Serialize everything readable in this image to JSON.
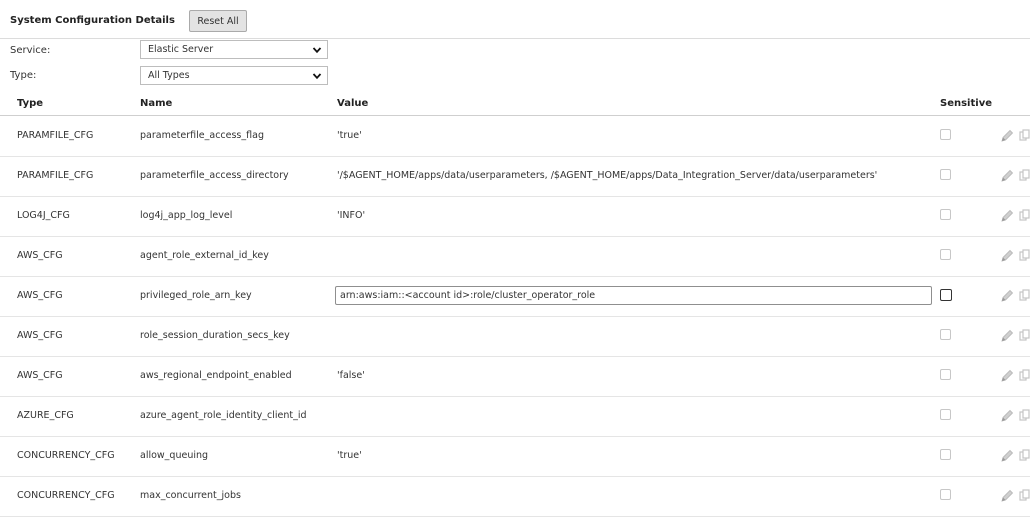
{
  "header": {
    "title": "System Configuration Details",
    "reset_label": "Reset All"
  },
  "filters": {
    "service_label": "Service:",
    "service_value": "Elastic Server",
    "type_label": "Type:",
    "type_value": "All Types"
  },
  "columns": {
    "type": "Type",
    "name": "Name",
    "value": "Value",
    "sensitive": "Sensitive"
  },
  "rows": [
    {
      "type": "PARAMFILE_CFG",
      "name": "parameterfile_access_flag",
      "value": "'true'",
      "editing": false
    },
    {
      "type": "PARAMFILE_CFG",
      "name": "parameterfile_access_directory",
      "value": "'/$AGENT_HOME/apps/data/userparameters, /$AGENT_HOME/apps/Data_Integration_Server/data/userparameters'",
      "editing": false
    },
    {
      "type": "LOG4J_CFG",
      "name": "log4j_app_log_level",
      "value": "'INFO'",
      "editing": false
    },
    {
      "type": "AWS_CFG",
      "name": "agent_role_external_id_key",
      "value": "",
      "editing": false
    },
    {
      "type": "AWS_CFG",
      "name": "privileged_role_arn_key",
      "value": "arn:aws:iam::<account id>:role/cluster_operator_role",
      "editing": true
    },
    {
      "type": "AWS_CFG",
      "name": "role_session_duration_secs_key",
      "value": "",
      "editing": false
    },
    {
      "type": "AWS_CFG",
      "name": "aws_regional_endpoint_enabled",
      "value": "'false'",
      "editing": false
    },
    {
      "type": "AZURE_CFG",
      "name": "azure_agent_role_identity_client_id",
      "value": "",
      "editing": false
    },
    {
      "type": "CONCURRENCY_CFG",
      "name": "allow_queuing",
      "value": "'true'",
      "editing": false
    },
    {
      "type": "CONCURRENCY_CFG",
      "name": "max_concurrent_jobs",
      "value": "",
      "editing": false
    }
  ],
  "icons": {
    "edit": "pencil-icon",
    "copy": "copy-icon",
    "dropdown": "chevron-down-icon"
  },
  "colors": {
    "icon_gray": "#bdbdbd",
    "border": "#dcdcdc"
  }
}
